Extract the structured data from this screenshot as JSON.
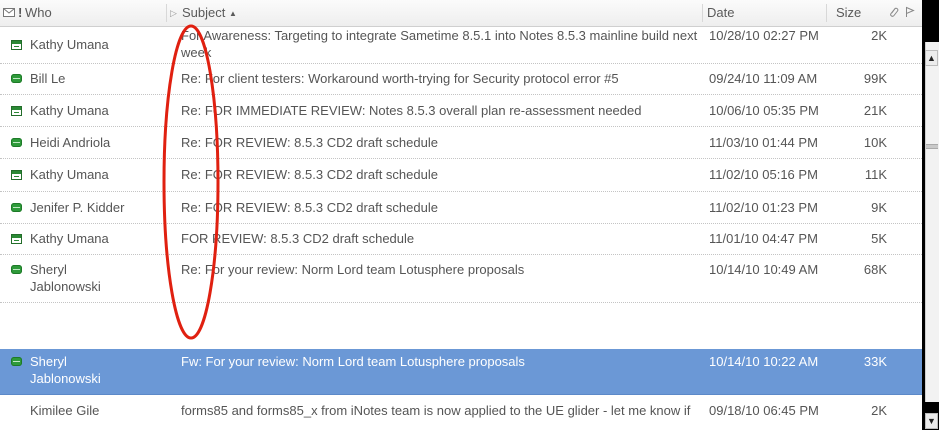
{
  "header": {
    "who_label": "Who",
    "subject_label": "Subject",
    "sort_indicator": "▲",
    "date_label": "Date",
    "size_label": "Size"
  },
  "icons": {
    "envelope": "envelope-icon",
    "importance": "exclamation-icon",
    "expand": "triangle-right-icon",
    "attachment": "paperclip-icon",
    "flag": "flag-icon",
    "message": "green-mail-icon",
    "meeting": "calendar-icon"
  },
  "colors": {
    "selected_row": "#6b98d6",
    "annotation_circle": "#e02010",
    "status_green": "#2e9a3a"
  },
  "messages": [
    {
      "icon": "cal",
      "who": "Kathy Umana",
      "subject_line1": "For Awareness: Targeting to integrate Sametime 8.5.1 into Notes 8.5.3 mainline build next",
      "subject_line2": "week",
      "date": "10/28/10 02:27 PM",
      "size": "2K"
    },
    {
      "icon": "mail",
      "who": "Bill Le",
      "subject_line1": "Re: For client testers:  Workaround worth-trying for Security protocol error #5",
      "date": "09/24/10 11:09 AM",
      "size": "99K"
    },
    {
      "icon": "cal",
      "who": "Kathy Umana",
      "subject_line1": "Re: FOR IMMEDIATE REVIEW: Notes 8.5.3 overall plan re-assessment needed",
      "date": "10/06/10 05:35 PM",
      "size": "21K"
    },
    {
      "icon": "mail",
      "who": "Heidi Andriola",
      "subject_line1": "Re: FOR REVIEW: 8.5.3 CD2 draft schedule",
      "date": "11/03/10 01:44 PM",
      "size": "10K"
    },
    {
      "icon": "cal",
      "who": "Kathy Umana",
      "subject_line1": "Re: FOR REVIEW: 8.5.3 CD2 draft schedule",
      "date": "11/02/10 05:16 PM",
      "size": "11K"
    },
    {
      "icon": "mail",
      "who": "Jenifer P. Kidder",
      "subject_line1": "Re: FOR REVIEW: 8.5.3 CD2 draft schedule",
      "date": "11/02/10 01:23 PM",
      "size": "9K"
    },
    {
      "icon": "cal",
      "who": "Kathy Umana",
      "subject_line1": "FOR REVIEW: 8.5.3 CD2 draft schedule",
      "date": "11/01/10 04:47 PM",
      "size": "5K"
    },
    {
      "icon": "mail",
      "who_line1": "Sheryl",
      "who_line2": "Jablonowski",
      "subject_line1": "Re: For your review:  Norm Lord team Lotusphere proposals",
      "date": "10/14/10 10:49 AM",
      "size": "68K"
    },
    {
      "icon": "mail",
      "who_line1": "Sheryl",
      "who_line2": "Jablonowski",
      "subject_line1": "Fw: For your review:  Norm Lord team Lotusphere proposals",
      "date": "10/14/10 10:22 AM",
      "size": "33K",
      "selected": true
    },
    {
      "icon": "none",
      "who": "Kimilee Gile",
      "subject_line1": "forms85 and forms85_x from iNotes team is now applied to the UE glider - let me know if",
      "date": "09/18/10 06:45 PM",
      "size": "2K"
    }
  ],
  "scrollbar": {
    "up_arrow": "▲",
    "down_arrow": "▼"
  }
}
